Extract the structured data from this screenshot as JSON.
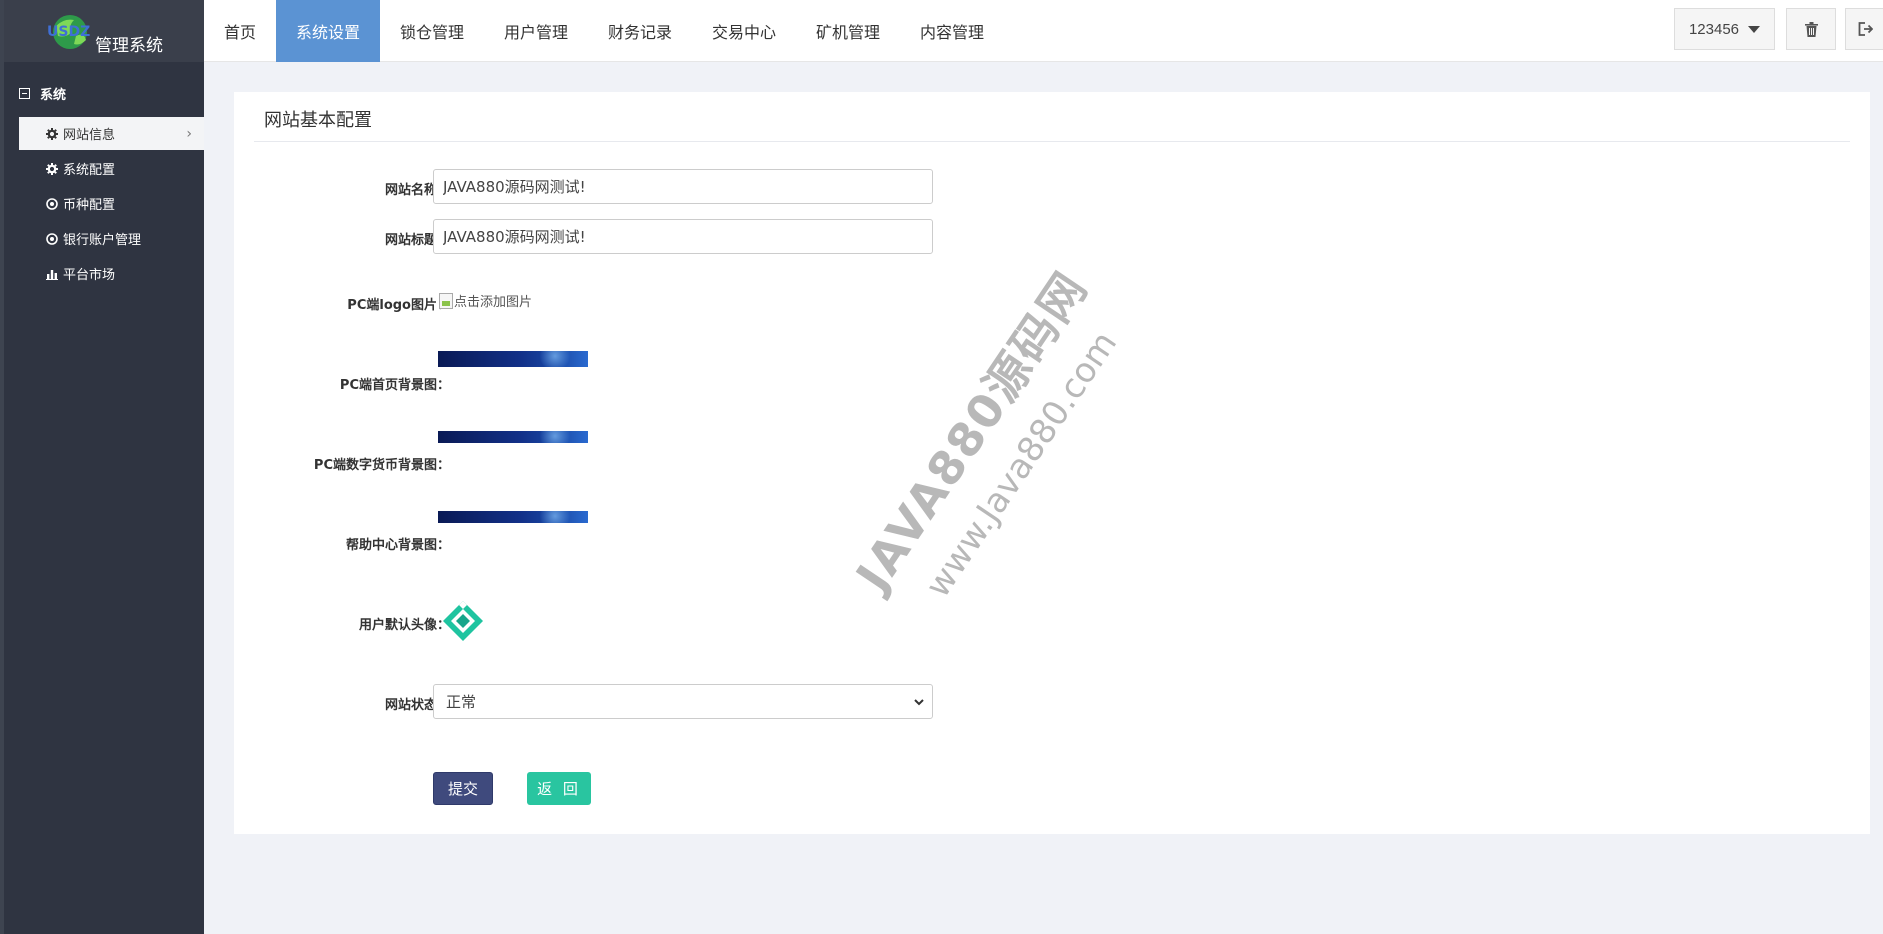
{
  "brand": {
    "logo_text": "USDZ",
    "title": "管理系统"
  },
  "sidebar": {
    "group_label": "系统",
    "items": [
      {
        "label": "网站信息",
        "icon": "gear-icon",
        "active": true
      },
      {
        "label": "系统配置",
        "icon": "gear-icon",
        "active": false
      },
      {
        "label": "币种配置",
        "icon": "circle-dot-icon",
        "active": false
      },
      {
        "label": "银行账户管理",
        "icon": "circle-dot-icon",
        "active": false
      },
      {
        "label": "平台市场",
        "icon": "bar-chart-icon",
        "active": false
      }
    ]
  },
  "topnav": {
    "tabs": [
      {
        "label": "首页",
        "active": false
      },
      {
        "label": "系统设置",
        "active": true
      },
      {
        "label": "锁仓管理",
        "active": false
      },
      {
        "label": "用户管理",
        "active": false
      },
      {
        "label": "财务记录",
        "active": false
      },
      {
        "label": "交易中心",
        "active": false
      },
      {
        "label": "矿机管理",
        "active": false
      },
      {
        "label": "内容管理",
        "active": false
      }
    ],
    "username": "123456",
    "icons": [
      "trash-icon",
      "logout-icon"
    ]
  },
  "panel": {
    "title": "网站基本配置",
    "fields": {
      "site_name": {
        "label": "网站名称：",
        "value": "JAVA880源码网测试!"
      },
      "site_title": {
        "label": "网站标题：",
        "value": "JAVA880源码网测试!"
      },
      "pc_logo": {
        "label": "PC端logo图片：",
        "alt": "点击添加图片"
      },
      "pc_home_bg": {
        "label": "PC端首页背景图："
      },
      "pc_coin_bg": {
        "label": "PC端数字货币背景图："
      },
      "help_bg": {
        "label": "帮助中心背景图："
      },
      "default_avatar": {
        "label": "用户默认头像："
      },
      "site_status": {
        "label": "网站状态：",
        "value": "正常"
      }
    },
    "submit_label": "提交",
    "back_label": "返 回"
  },
  "watermark": {
    "line1": "JAVA880源码网",
    "line2": "www.Java880.com"
  },
  "colors": {
    "sidebar_bg": "#2f3441",
    "nav_active": "#5b93d3",
    "submit": "#3f4a7d",
    "back": "#29c5a0"
  }
}
